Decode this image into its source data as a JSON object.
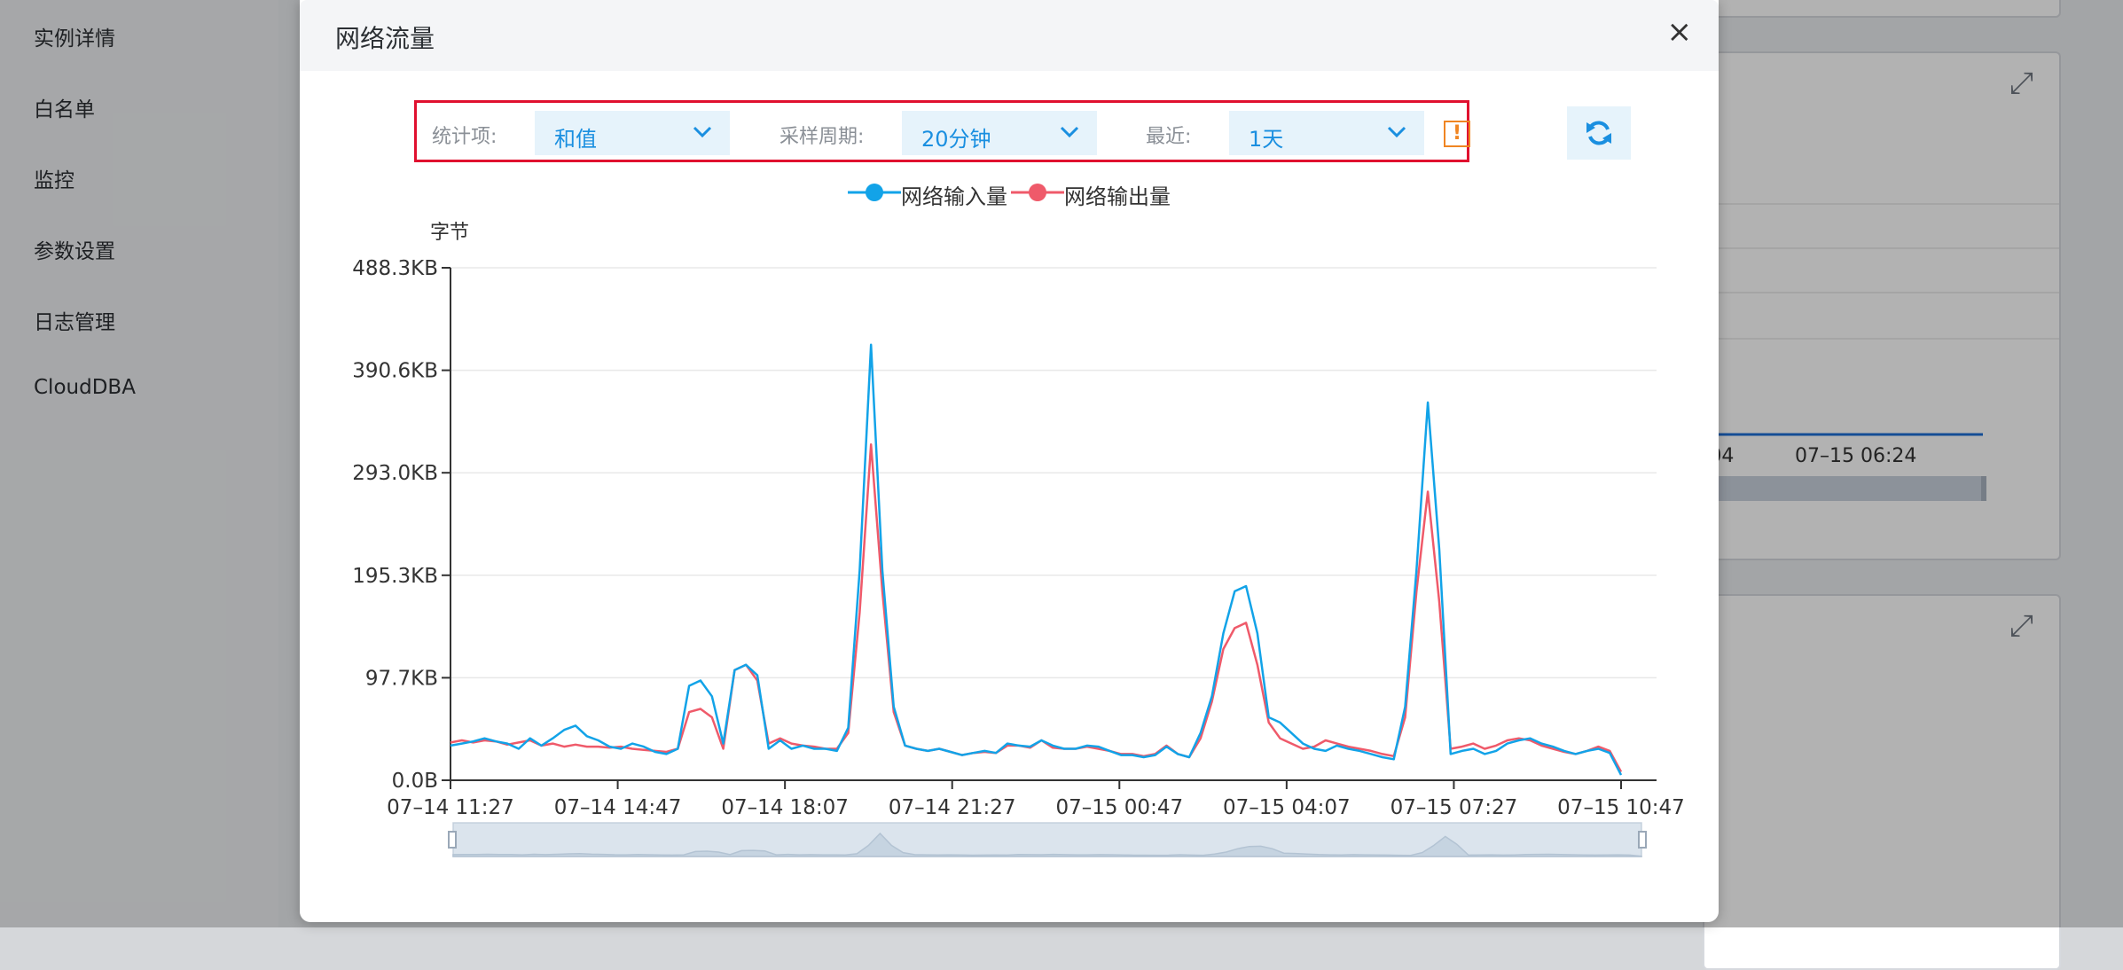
{
  "sidebar": {
    "items": [
      {
        "label": "实例详情"
      },
      {
        "label": "白名单"
      },
      {
        "label": "监控"
      },
      {
        "label": "参数设置"
      },
      {
        "label": "日志管理"
      },
      {
        "label": "CloudDBA"
      }
    ]
  },
  "background": {
    "ticks": [
      ":04",
      "07–15 06:24"
    ],
    "partial_axis_label": "%"
  },
  "modal": {
    "title": "网络流量",
    "close_glyph": "×",
    "filters": {
      "stat_label": "统计项:",
      "stat_value": "和值",
      "period_label": "采样周期:",
      "period_value": "20分钟",
      "range_label": "最近:",
      "range_value": "1天",
      "warning_glyph": "!"
    },
    "refresh_icon": "refresh-icon"
  },
  "colors": {
    "accent": "#1a8fe0",
    "series_in": "#12a3e8",
    "series_out": "#ef5a6a",
    "warning": "#f08522",
    "highlight": "#e0102f"
  },
  "chart_data": {
    "type": "line",
    "ylabel": "字节",
    "y_ticks": [
      "0.0B",
      "97.7KB",
      "195.3KB",
      "293.0KB",
      "390.6KB",
      "488.3KB"
    ],
    "ylim": [
      0,
      488.3
    ],
    "y_unit": "KB",
    "x_ticks": [
      "07–14 11:27",
      "07–14 14:47",
      "07–14 18:07",
      "07–14 21:27",
      "07–15 00:47",
      "07–15 04:07",
      "07–15 07:27",
      "07–15 10:47"
    ],
    "legend": "top-center",
    "grid": true,
    "has_zoom_slider": true,
    "series": [
      {
        "name": "网络输入量",
        "values": [
          33,
          35,
          37,
          40,
          37,
          35,
          30,
          40,
          33,
          40,
          48,
          52,
          42,
          38,
          32,
          30,
          35,
          32,
          27,
          25,
          30,
          90,
          95,
          80,
          35,
          105,
          110,
          100,
          30,
          38,
          30,
          33,
          30,
          30,
          28,
          50,
          200,
          415,
          200,
          70,
          33,
          30,
          28,
          30,
          27,
          24,
          26,
          28,
          26,
          35,
          33,
          32,
          38,
          33,
          30,
          30,
          33,
          32,
          28,
          24,
          24,
          22,
          24,
          32,
          25,
          22,
          45,
          80,
          140,
          180,
          185,
          140,
          60,
          55,
          45,
          35,
          30,
          28,
          33,
          30,
          28,
          25,
          22,
          20,
          70,
          200,
          360,
          220,
          25,
          28,
          30,
          25,
          28,
          35,
          38,
          40,
          35,
          32,
          28,
          25,
          28,
          30,
          26,
          5
        ]
      },
      {
        "name": "网络输出量",
        "values": [
          36,
          38,
          36,
          38,
          37,
          34,
          36,
          38,
          33,
          35,
          32,
          34,
          32,
          32,
          31,
          32,
          30,
          29,
          28,
          27,
          30,
          65,
          68,
          60,
          30,
          105,
          110,
          95,
          35,
          40,
          35,
          33,
          32,
          30,
          30,
          45,
          160,
          320,
          180,
          65,
          33,
          30,
          28,
          30,
          27,
          24,
          26,
          27,
          26,
          33,
          33,
          31,
          38,
          31,
          30,
          30,
          32,
          30,
          28,
          25,
          25,
          23,
          25,
          33,
          25,
          22,
          40,
          75,
          125,
          145,
          150,
          110,
          55,
          40,
          35,
          30,
          32,
          38,
          35,
          32,
          30,
          28,
          25,
          23,
          60,
          180,
          275,
          170,
          30,
          32,
          35,
          30,
          33,
          38,
          40,
          38,
          33,
          30,
          27,
          25,
          28,
          32,
          28,
          8
        ]
      }
    ]
  }
}
